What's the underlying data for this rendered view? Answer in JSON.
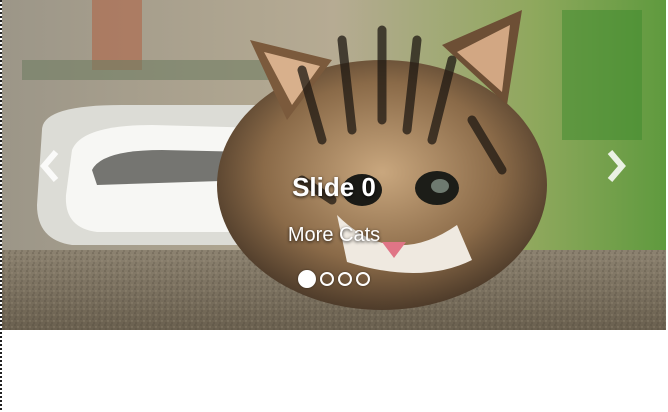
{
  "carousel": {
    "caption_title": "Slide 0",
    "caption_subtitle": "More Cats",
    "image_subject": "kitten on countertop",
    "prev_icon": "chevron-left-icon",
    "next_icon": "chevron-right-icon",
    "slide_count": 4,
    "active_index": 0
  }
}
